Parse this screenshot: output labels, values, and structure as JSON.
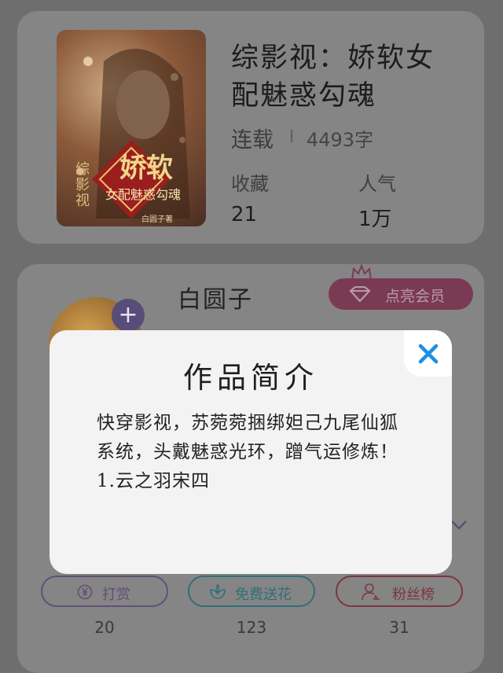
{
  "book": {
    "title": "综影视：娇软女配魅惑勾魂",
    "status": "连载",
    "word_count": "4493字",
    "stats": [
      {
        "label": "收藏",
        "value": "21"
      },
      {
        "label": "人气",
        "value": "1万"
      }
    ],
    "cover": {
      "side_text": "综影视",
      "main_text": "娇软",
      "sub_text": "女配魅惑勾魂",
      "author_text": "白圆子著"
    }
  },
  "author": {
    "name": "白圆子",
    "vip_label": "点亮会员",
    "follow_icon": "plus-icon"
  },
  "actions": [
    {
      "label": "打赏",
      "count": "20",
      "icon": "yuan-coin-icon",
      "color": "#624f7a"
    },
    {
      "label": "免费送花",
      "count": "123",
      "icon": "flower-icon",
      "color": "#2f6f78"
    },
    {
      "label": "粉丝榜",
      "count": "31",
      "icon": "user-rank-icon",
      "color": "#7a3740"
    }
  ],
  "modal": {
    "title": "作品简介",
    "body": "快穿影视，苏菀菀捆绑妲己九尾仙狐系统，头戴魅惑光环，蹭气运修炼！\n1.云之羽宋四",
    "close_icon": "close-icon",
    "accent": "#1a8fe3"
  },
  "colors": {
    "overlay_bg": "#6e6e6e",
    "modal_bg": "#f3f3f3"
  }
}
